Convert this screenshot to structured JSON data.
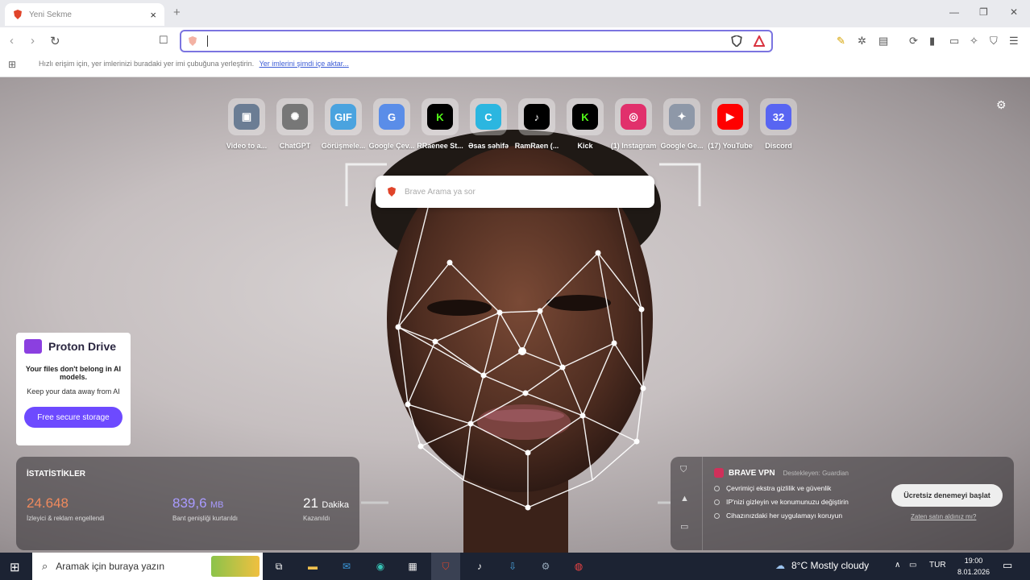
{
  "tab": {
    "title": "Yeni Sekme",
    "close": "×"
  },
  "window": {
    "new_tab": "+",
    "minimize": "—",
    "maximize": "❐",
    "close": "✕"
  },
  "address_bar": {
    "value": ""
  },
  "bookmarks_bar": {
    "message": "Hızlı erişim için, yer imlerinizi buradaki yer imi çubuğuna yerleştirin.",
    "import_link": "Yer imlerini şimdi içe aktar..."
  },
  "top_sites": [
    {
      "label": "Video to a...",
      "icon": "video-converter-icon",
      "color": "#6b7d94",
      "glyph": "▣"
    },
    {
      "label": "ChatGPT",
      "icon": "chatgpt-icon",
      "color": "#777777",
      "glyph": "✺"
    },
    {
      "label": "Görüşmele...",
      "icon": "gif-icon",
      "color": "#4aa3df",
      "glyph": "GIF"
    },
    {
      "label": "Google Çev...",
      "icon": "google-translate-icon",
      "color": "#5a8de8",
      "glyph": "G"
    },
    {
      "label": "RRaenee St...",
      "icon": "kick-icon",
      "color": "#000000",
      "glyph": "K"
    },
    {
      "label": "Əsas səhifə",
      "icon": "canva-icon",
      "color": "#2bb6e0",
      "glyph": "C"
    },
    {
      "label": "RamRaen (...",
      "icon": "tiktok-icon",
      "color": "#000000",
      "glyph": "♪"
    },
    {
      "label": "Kick",
      "icon": "kick-icon",
      "color": "#000000",
      "glyph": "K"
    },
    {
      "label": "(1) Instagram",
      "icon": "instagram-icon",
      "color": "#e1306c",
      "glyph": "◎"
    },
    {
      "label": "Google Ge...",
      "icon": "gemini-icon",
      "color": "#8e98a8",
      "glyph": "✦"
    },
    {
      "label": "(17) YouTube",
      "icon": "youtube-icon",
      "color": "#ff0000",
      "glyph": "▶"
    },
    {
      "label": "Discord",
      "icon": "calendar-icon",
      "color": "#5865f2",
      "glyph": "32"
    }
  ],
  "search": {
    "placeholder": "Brave Arama ya sor"
  },
  "proton": {
    "brand": "Proton Drive",
    "headline": "Your files don't belong in AI models.",
    "subline": "Keep your data away from AI",
    "button": "Free secure storage"
  },
  "stats": {
    "title": "İSTATİSTİKLER",
    "trackers_value": "24.648",
    "trackers_label": "İzleyici & reklam engellendi",
    "bandwidth_value": "839,6",
    "bandwidth_unit": "MB",
    "bandwidth_label": "Bant genişliği kurtarıldı",
    "time_value": "21",
    "time_unit": "Dakika",
    "time_label": "Kazanıldı"
  },
  "vpn": {
    "title": "BRAVE VPN",
    "powered": "Destekleyen: Guardian",
    "items": [
      "Çevrimiçi ekstra gizlilik ve güvenlik",
      "IP'nizi gizleyin ve konumunuzu değiştirin",
      "Cihazınızdaki her uygulamayı koruyun"
    ],
    "button": "Ücretsiz denemeyi başlat",
    "link": "Zaten satın aldınız mı?"
  },
  "taskbar": {
    "search_placeholder": "Aramak için buraya yazın",
    "weather": "8°C  Mostly cloudy",
    "lang": "TUR",
    "time": "19:00",
    "date": "8.01.2026"
  },
  "colors": {
    "accent": "#7b74e0",
    "proton": "#6d4aff",
    "trackers": "#f08a5d",
    "bandwidth": "#a99bff"
  }
}
